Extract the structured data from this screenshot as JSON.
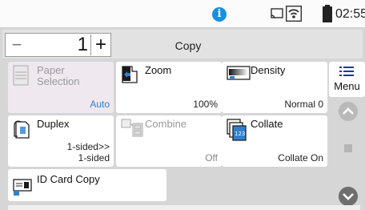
{
  "status": {
    "time": "02:55",
    "info_icon": "info-icon",
    "cast_icon": "cast-icon",
    "wifi_icon": "wifi-icon",
    "battery_icon": "battery-icon"
  },
  "topbar": {
    "minus_label": "−",
    "quantity": "1",
    "plus_label": "+",
    "title": "Copy"
  },
  "tiles": {
    "paper": {
      "title": "Paper Selection",
      "value": "Auto",
      "icon": "paper-icon"
    },
    "zoom": {
      "title": "Zoom",
      "value": "100%",
      "icon": "zoom-icon"
    },
    "density": {
      "title": "Density",
      "value": "Normal 0",
      "icon": "density-icon"
    },
    "duplex": {
      "title": "Duplex",
      "value": "1-sided>>\n1-sided",
      "icon": "duplex-icon"
    },
    "combine": {
      "title": "Combine",
      "value": "Off",
      "icon": "combine-icon"
    },
    "collate": {
      "title": "Collate",
      "value": "Collate On",
      "icon": "collate-icon"
    },
    "idcard": {
      "title": "ID Card Copy",
      "icon": "id-card-icon"
    }
  },
  "menu": {
    "label": "Menu",
    "icon": "list-icon"
  },
  "colors": {
    "accent": "#2f7fd1",
    "info": "#1a8fe0",
    "disabled_tile": "#efe9ef",
    "background": "#d6d6d6"
  }
}
